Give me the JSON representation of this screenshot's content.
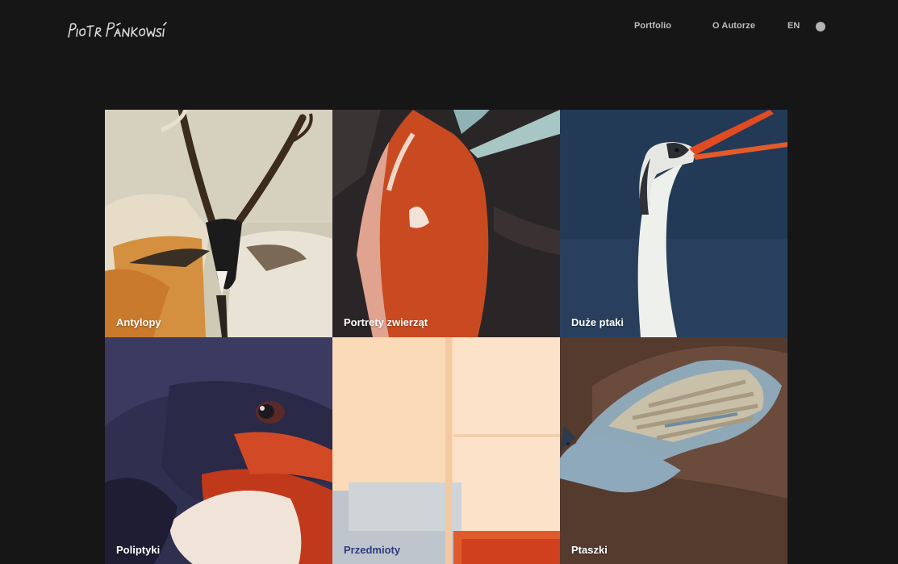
{
  "header": {
    "logo_text": "Piotr Pańkowski",
    "nav": {
      "portfolio": "Portfolio",
      "author": "O Autorze",
      "lang": "EN"
    }
  },
  "gallery": {
    "tiles": [
      {
        "label": "Antylopy"
      },
      {
        "label": "Portrety zwierząt"
      },
      {
        "label": "Duże ptaki"
      },
      {
        "label": "Poliptyki"
      },
      {
        "label": "Przedmioty"
      },
      {
        "label": "Ptaszki"
      }
    ]
  },
  "colors": {
    "background": "#161616",
    "nav_text": "#bdbdbd",
    "label_text": "#ffffff",
    "label_text_dark": "#2d3b7c"
  }
}
